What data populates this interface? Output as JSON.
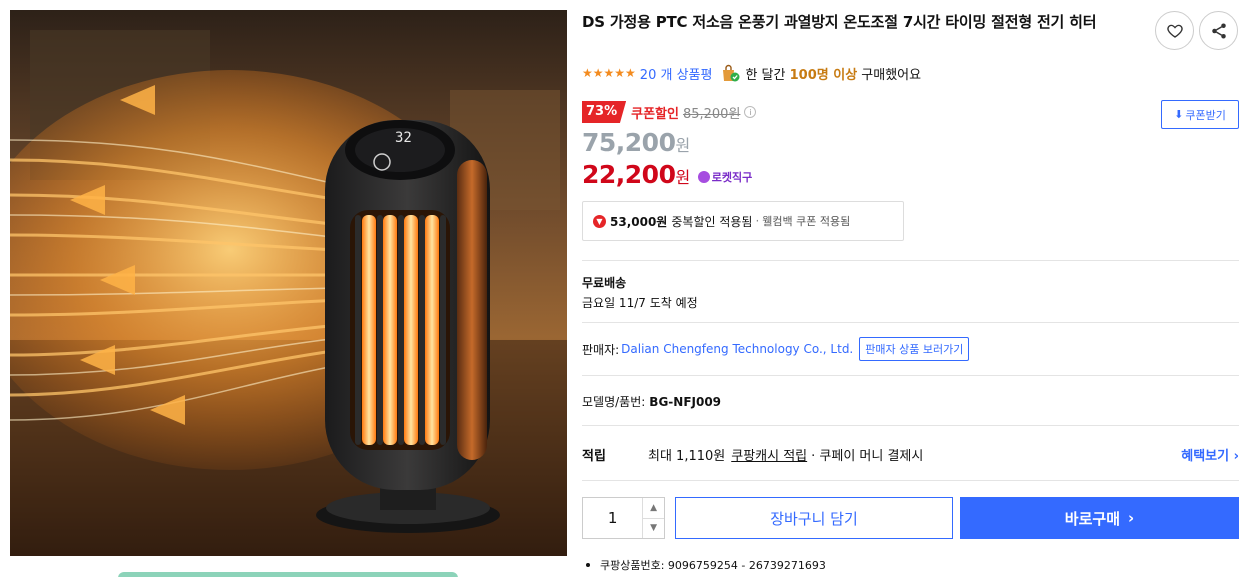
{
  "product": {
    "title": "DS 가정용 PTC 저소음 온풍기 과열방지 온도조절 7시간 타이밍 절전형 전기 히터",
    "image_display_temp": "32"
  },
  "rating": {
    "stars": "★★★★★",
    "review_count": "20 개 상품평",
    "buy_prefix": "한 달간",
    "buy_highlight": "100명 이상",
    "buy_suffix": "구매했어요"
  },
  "discount": {
    "percent": "73%",
    "coupon_label": "쿠폰할인",
    "original_price": "85,200원",
    "info_glyph": "i",
    "coupon_button": "쿠폰받기"
  },
  "prices": {
    "sale_price": "75,200",
    "coupon_price": "22,200",
    "won": "원",
    "rocket_label": "로켓직구"
  },
  "extra_discount": {
    "amount": "53,000원",
    "text": "중복할인 적용됨",
    "sep": "·",
    "sub": "웰컴백 쿠폰 적용됨"
  },
  "shipping": {
    "label": "무료배송",
    "date": "금요일 11/7 도착 예정"
  },
  "seller": {
    "label": "판매자:",
    "name": "Dalian Chengfeng Technology Co., Ltd.",
    "link": "판매자 상품 보러가기"
  },
  "model": {
    "label": "모델명/품번:",
    "value": "BG-NFJ009"
  },
  "points": {
    "label": "적립",
    "max": "최대 1,110원",
    "cash": "쿠팡캐시 적립",
    "pay": "· 쿠페이 머니 결제시",
    "benefit_link": "혜택보기 ›"
  },
  "purchase": {
    "quantity": "1",
    "up": "▲",
    "down": "▼",
    "cart": "장바구니 담기",
    "buy": "바로구매",
    "buy_chev": "›"
  },
  "product_number": "쿠팡상품번호: 9096759254 - 26739271693",
  "colors": {
    "accent_blue": "#346aff",
    "sale_red": "#d0071a",
    "discount_red": "#e52528",
    "star_orange": "#f38b1f",
    "rocket_purple": "#7a2cc8"
  }
}
